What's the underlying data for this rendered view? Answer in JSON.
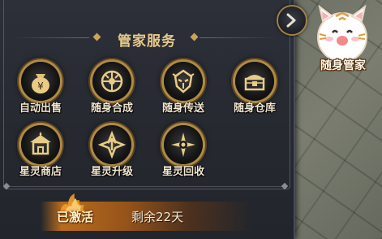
{
  "header": {
    "title": "管家服务"
  },
  "services": [
    {
      "label": "自动出售"
    },
    {
      "label": "随身合成"
    },
    {
      "label": "随身传送"
    },
    {
      "label": "随身仓库"
    },
    {
      "label": "星灵商店"
    },
    {
      "label": "星灵升级"
    },
    {
      "label": "星灵回收"
    }
  ],
  "status": {
    "active": "已激活",
    "remaining": "剩余22天"
  },
  "mascot": {
    "label": "随身管家"
  },
  "colors": {
    "accent_gold": "#c9a458",
    "title_gold": "#e8c98a",
    "status_orange": "#d27819"
  }
}
